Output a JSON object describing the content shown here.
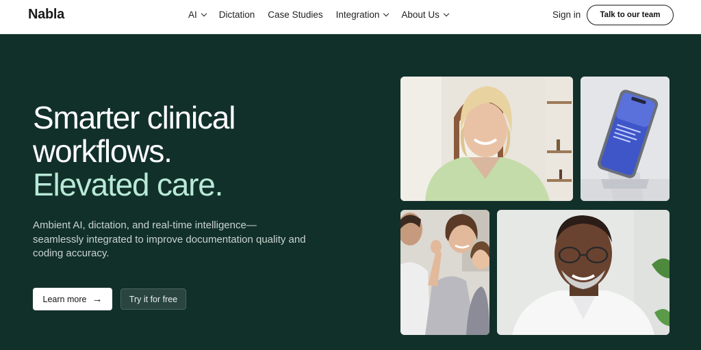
{
  "header": {
    "logo": "Nabla",
    "nav": [
      {
        "label": "AI",
        "has_dropdown": true
      },
      {
        "label": "Dictation",
        "has_dropdown": false
      },
      {
        "label": "Case Studies",
        "has_dropdown": false
      },
      {
        "label": "Integration",
        "has_dropdown": true
      },
      {
        "label": "About Us",
        "has_dropdown": true
      }
    ],
    "sign_in": "Sign in",
    "cta": "Talk to our team"
  },
  "hero": {
    "title_line1": "Smarter clinical",
    "title_line2": "workflows.",
    "title_accent": "Elevated care.",
    "subtitle": "Ambient AI, dictation, and real-time intelligence—seamlessly integrated to improve documentation quality and coding accuracy.",
    "primary_button": "Learn more",
    "secondary_button": "Try it for free"
  },
  "colors": {
    "background": "#12302a",
    "accent_text": "#b8ead7",
    "header_bg": "#ffffff"
  },
  "icons": {
    "arrow": "arrow-right-icon",
    "dropdown": "chevron-down-icon"
  }
}
